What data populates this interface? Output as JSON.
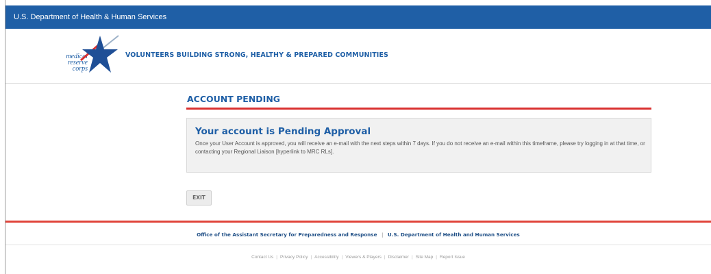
{
  "topbar": {
    "agency": "U.S. Department of Health & Human Services"
  },
  "header": {
    "logo_text": [
      "medical",
      "reserve",
      "corps"
    ],
    "tagline": "VOLUNTEERS BUILDING STRONG, HEALTHY & PREPARED COMMUNITIES"
  },
  "main": {
    "page_title": "ACCOUNT PENDING",
    "notice": {
      "title": "Your account is Pending Approval",
      "body": "Once your User Account is approved, you will receive an e-mail with the next steps within 7 days. If you do not receive an e-mail within this timeframe, please try logging in at that time, or contacting your Regional Liaison [hyperlink to MRC RLs]."
    },
    "exit_label": "EXIT"
  },
  "footer": {
    "org1": "Office of the Assistant Secretary for Preparedness and Response",
    "separator": "|",
    "org2": "U.S. Department of Health and Human Services",
    "links": [
      "Contact Us",
      "Privacy Policy",
      "Accessibility",
      "Viewers & Players",
      "Disclaimer",
      "Site Map",
      "Report Issue"
    ]
  },
  "colors": {
    "brand_blue": "#1f5fa6",
    "accent_red": "#d9302f",
    "footer_red": "#e0443a"
  }
}
